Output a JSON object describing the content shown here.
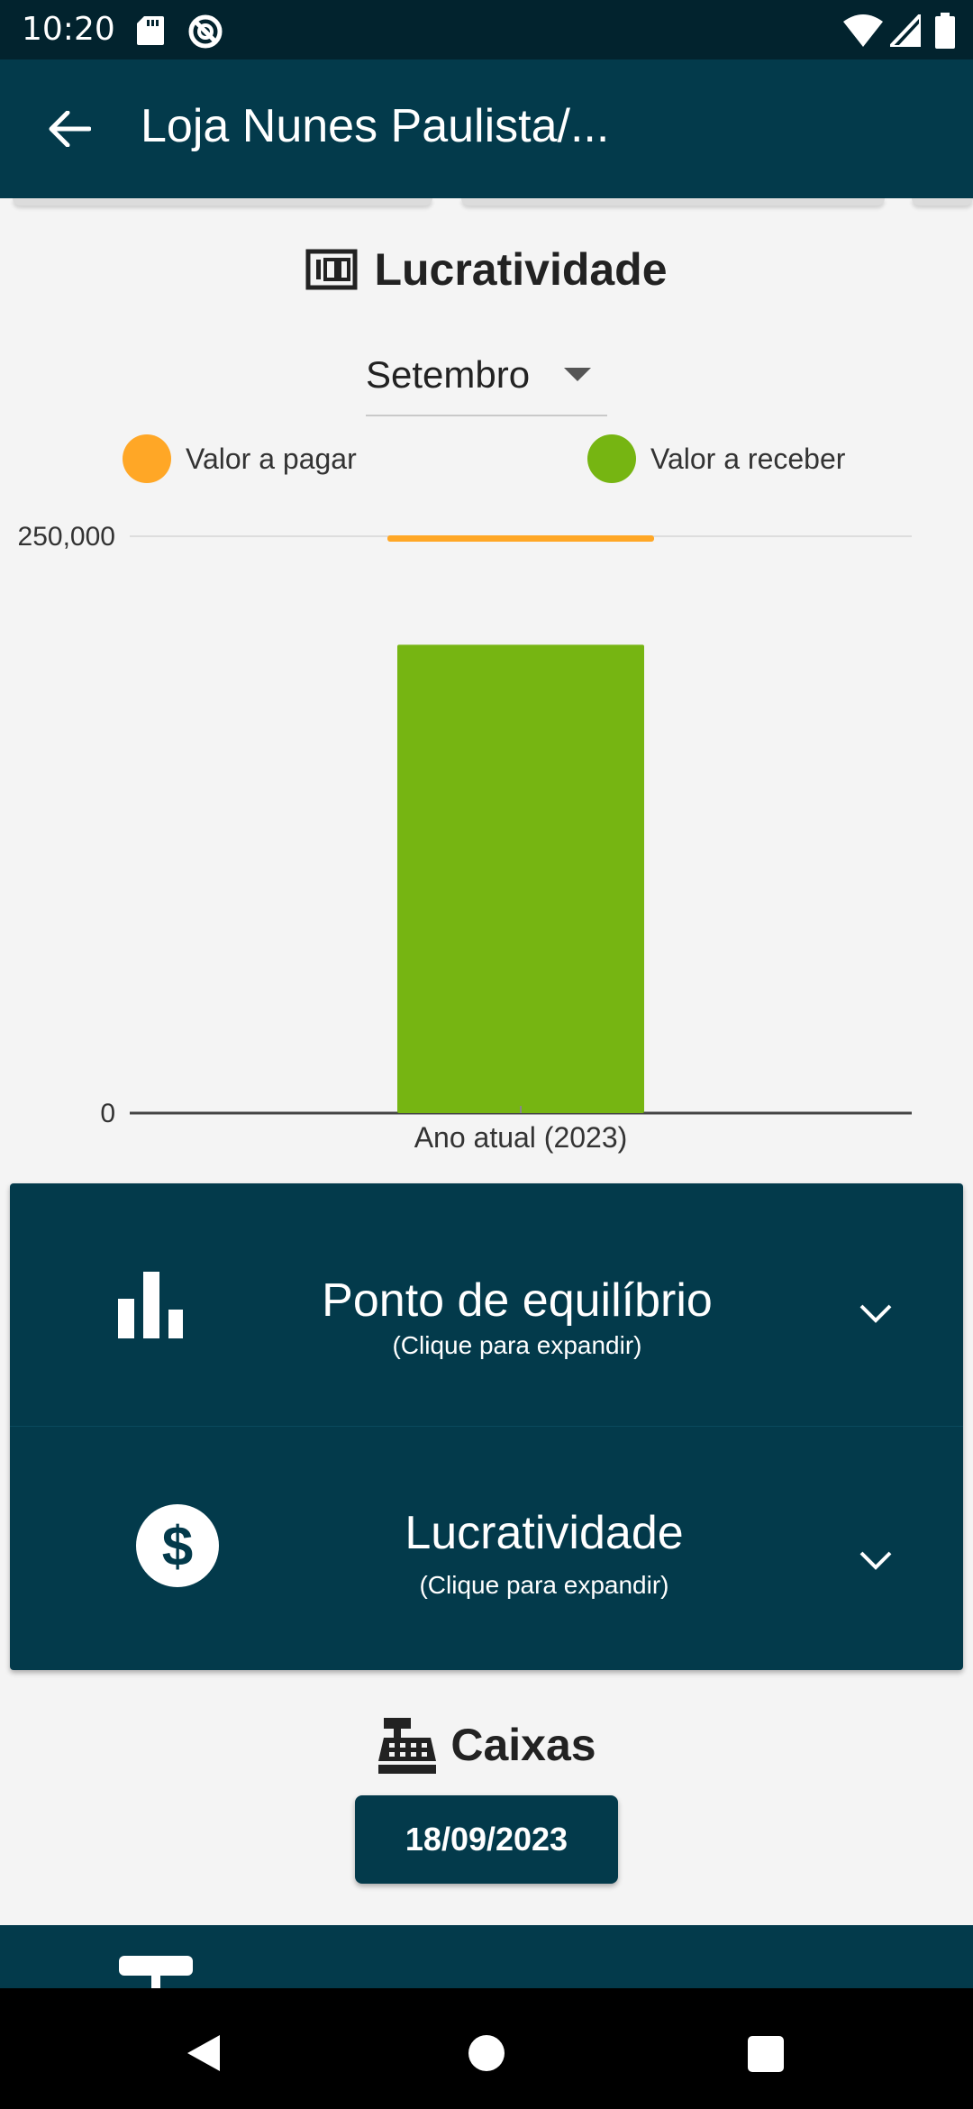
{
  "status_bar": {
    "time": "10:20",
    "icons": [
      "sd-card-icon",
      "do-not-disturb-icon",
      "wifi-icon",
      "signal-icon",
      "battery-icon"
    ]
  },
  "app_bar": {
    "title": "Loja Nunes Paulista/...",
    "back_icon": "arrow-back-icon"
  },
  "profit_section": {
    "title": "Lucratividade",
    "icon": "hundred-icon",
    "month": "Setembro"
  },
  "legend": [
    {
      "label": "Valor a pagar",
      "color": "#ffa726"
    },
    {
      "label": "Valor a receber",
      "color": "#76b512"
    }
  ],
  "chart_data": {
    "type": "bar",
    "categories": [
      "Ano atual (2023)"
    ],
    "series": [
      {
        "name": "Valor a pagar",
        "values": [
          250000
        ],
        "color": "#ffa726"
      },
      {
        "name": "Valor a receber",
        "values": [
          203000
        ],
        "color": "#76b512"
      }
    ],
    "ylim": [
      0,
      250000
    ],
    "y_ticks": [
      "0",
      "250,000"
    ],
    "grid": true,
    "legend_position": "top"
  },
  "cards": [
    {
      "title": "Ponto de equilíbrio",
      "subtitle": "(Clique para expandir)",
      "icon": "bar-chart-icon"
    },
    {
      "title": "Lucratividade",
      "subtitle": "(Clique para expandir)",
      "icon": "dollar-circle-icon"
    }
  ],
  "caixas": {
    "title": "Caixas",
    "icon": "cash-register-icon",
    "date": "18/09/2023"
  },
  "colors": {
    "primary": "#033a4b",
    "status_bar": "#02232e",
    "background": "#f4f4f4"
  }
}
